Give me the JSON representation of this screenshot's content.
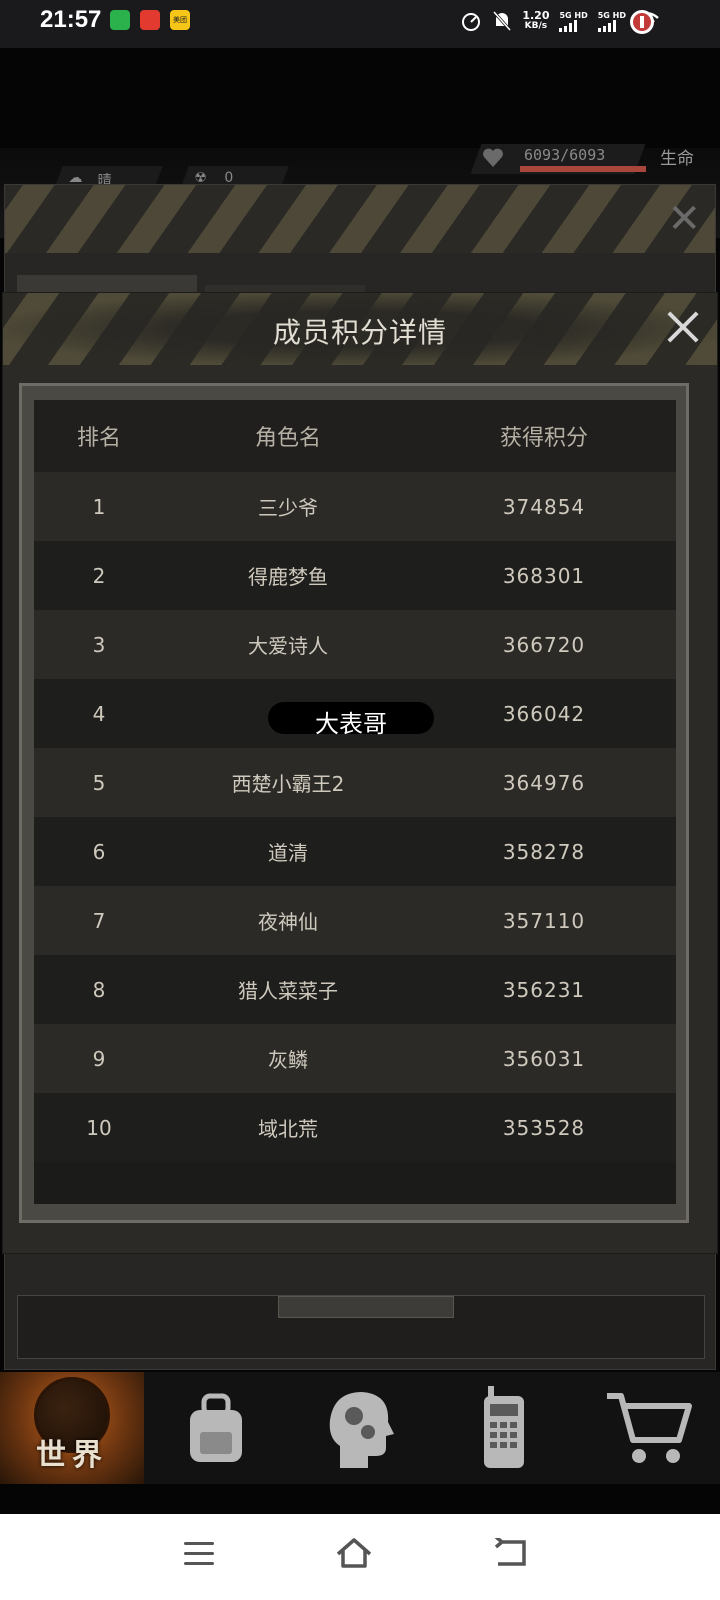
{
  "status_bar": {
    "time": "21:57",
    "apps": [
      {
        "name": "bilibili-app-icon",
        "color": "#2bb24c"
      },
      {
        "name": "netease-music-app-icon",
        "color": "#e33a2f"
      },
      {
        "name": "meituan-app-icon",
        "color": "#f5c518",
        "text": "美团"
      }
    ],
    "net_speed_value": "1.20",
    "net_speed_unit": "KB/s",
    "signal1": "5G HD",
    "signal2": "5G HD"
  },
  "hud": {
    "weather": "晴",
    "radiation": "0",
    "hp": "6093/6093",
    "hp_fraction": 1.0,
    "hp_label": "生命"
  },
  "modal": {
    "title": "成员积分详情",
    "columns": {
      "rank": "排名",
      "name": "角色名",
      "points": "获得积分"
    },
    "rows": [
      {
        "rank": "1",
        "name": "三少爷",
        "points": "374854"
      },
      {
        "rank": "2",
        "name": "得鹿梦鱼",
        "points": "368301"
      },
      {
        "rank": "3",
        "name": "大爱诗人",
        "points": "366720"
      },
      {
        "rank": "4",
        "name": "",
        "points": "366042"
      },
      {
        "rank": "5",
        "name": "西楚小霸王2",
        "points": "364976"
      },
      {
        "rank": "6",
        "name": "道清",
        "points": "358278"
      },
      {
        "rank": "7",
        "name": "夜神仙",
        "points": "357110"
      },
      {
        "rank": "8",
        "name": "猎人菜菜子",
        "points": "356231"
      },
      {
        "rank": "9",
        "name": "灰鳞",
        "points": "356031"
      },
      {
        "rank": "10",
        "name": "域北荒",
        "points": "353528"
      }
    ],
    "redaction_overlay_text": "大表哥"
  },
  "bottom_nav": {
    "world_label": "世界",
    "items": [
      "backpack-icon",
      "skills-head-icon",
      "radio-icon",
      "shop-cart-icon"
    ]
  },
  "colors": {
    "accent_orange": "#c2621c",
    "hp_red": "#a8453c",
    "hazard_yellow": "#6c6446"
  }
}
